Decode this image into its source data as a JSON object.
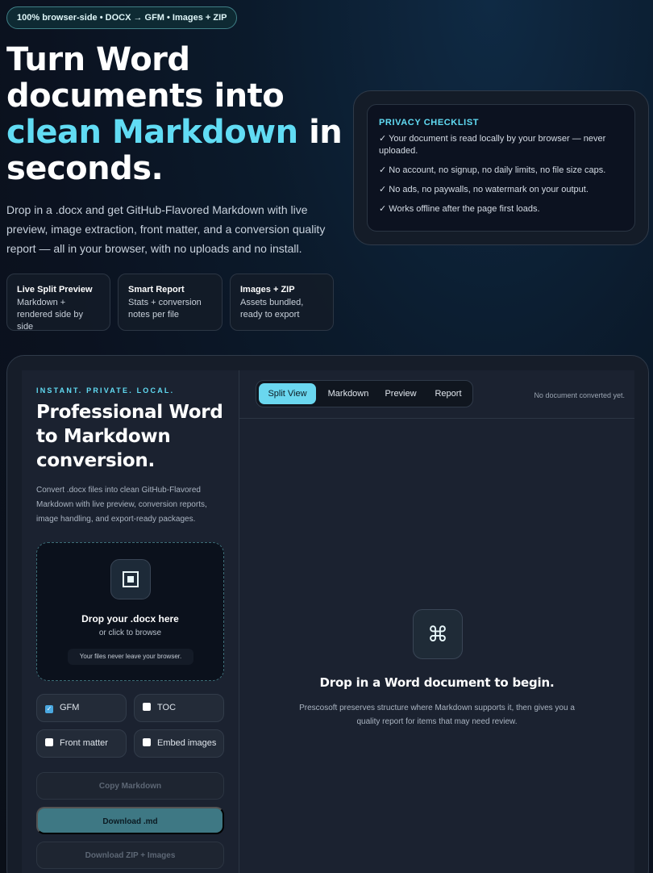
{
  "badge": "100% browser-side • DOCX → GFM • Images + ZIP",
  "hero": {
    "title_1": "Turn Word documents into",
    "title_accent": "clean Markdown",
    "title_2": "in seconds.",
    "description": "Drop in a .docx and get GitHub-Flavored Markdown with live preview, image extraction, front matter, and a conversion quality report — all in your browser, with no uploads and no install."
  },
  "features": [
    {
      "title": "Live Split Preview",
      "text": "Markdown + rendered side by side"
    },
    {
      "title": "Smart Report",
      "text": "Stats + conversion notes per file"
    },
    {
      "title": "Images + ZIP",
      "text": "Assets bundled, ready to export"
    }
  ],
  "privacy": {
    "heading": "PRIVACY CHECKLIST",
    "items": [
      "✓ Your document is read locally by your browser — never uploaded.",
      "✓ No account, no signup, no daily limits, no file size caps.",
      "✓ No ads, no paywalls, no watermark on your output.",
      "✓ Works offline after the page first loads."
    ]
  },
  "sidebar": {
    "kicker": "INSTANT. PRIVATE. LOCAL.",
    "title": "Professional Word to Markdown conversion.",
    "description": "Convert .docx files into clean GitHub-Flavored Markdown with live preview, conversion reports, image handling, and export-ready packages.",
    "dropzone": {
      "icon": "document-icon",
      "title": "Drop your .docx here",
      "subtitle": "or click to browse",
      "note": "Your files never leave your browser."
    },
    "options": [
      {
        "label": "GFM",
        "checked": true
      },
      {
        "label": "TOC",
        "checked": false
      },
      {
        "label": "Front matter",
        "checked": false
      },
      {
        "label": "Embed images",
        "checked": false
      }
    ],
    "actions": {
      "copy": "Copy Markdown",
      "download_md": "Download .md",
      "download_zip": "Download ZIP + Images"
    }
  },
  "main": {
    "tabs": [
      "Split View",
      "Markdown",
      "Preview",
      "Report"
    ],
    "active_tab": "Split View",
    "status": "No document converted yet.",
    "empty": {
      "icon": "command-icon",
      "title": "Drop in a Word document to begin.",
      "description": "Prescosoft preserves structure where Markdown supports it, then gives you a quality report for items that may need review."
    }
  },
  "colors": {
    "accent": "#61dcf4",
    "primary_button": "#3e7884",
    "background": "#0b1220"
  }
}
